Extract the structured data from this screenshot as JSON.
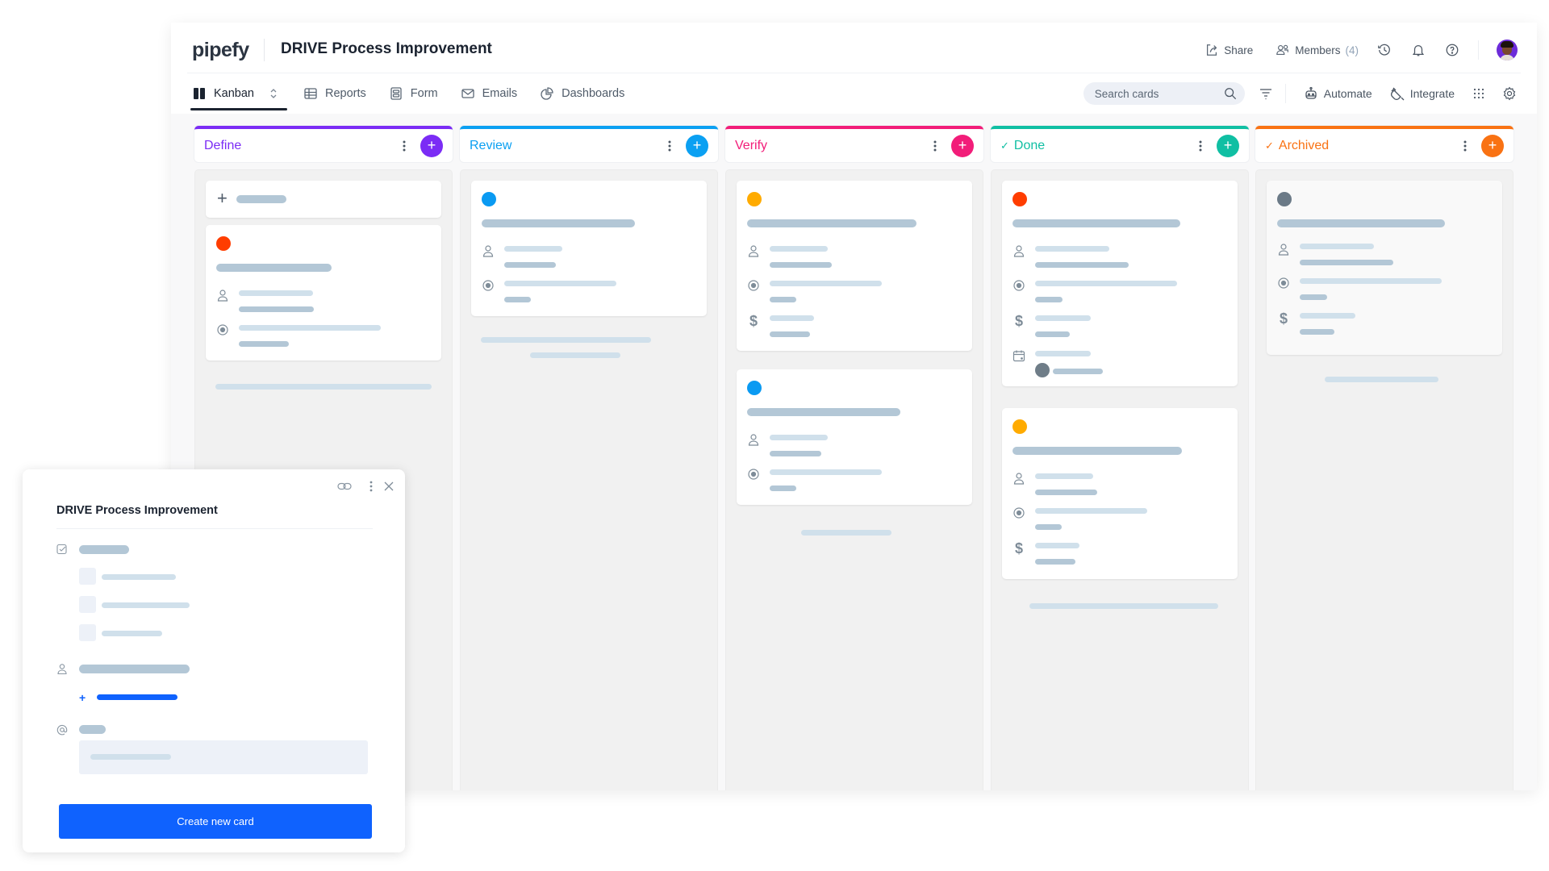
{
  "header": {
    "logo": "pipefy",
    "title": "DRIVE Process Improvement",
    "share_label": "Share",
    "members_label": "Members",
    "members_count": "(4)",
    "icons": [
      "history-icon",
      "bell-icon",
      "help-icon"
    ],
    "avatar": "user-avatar"
  },
  "tabs": [
    {
      "label": "Kanban",
      "icon": "kanban-icon",
      "active": true
    },
    {
      "label": "Reports",
      "icon": "table-icon",
      "active": false
    },
    {
      "label": "Form",
      "icon": "form-icon",
      "active": false
    },
    {
      "label": "Emails",
      "icon": "mail-icon",
      "active": false
    },
    {
      "label": "Dashboards",
      "icon": "pie-chart-icon",
      "active": false
    }
  ],
  "toolbar": {
    "search_placeholder": "Search cards",
    "automate_label": "Automate",
    "integrate_label": "Integrate"
  },
  "columns": [
    {
      "title": "Define",
      "color": "#7b2cf5",
      "done_check": false
    },
    {
      "title": "Review",
      "color": "#0ba0f2",
      "done_check": false
    },
    {
      "title": "Verify",
      "color": "#f21d79",
      "done_check": false
    },
    {
      "title": "Done",
      "color": "#10bfa3",
      "done_check": true
    },
    {
      "title": "Archived",
      "color": "#f97213",
      "done_check": true
    }
  ],
  "card_colors": {
    "red": "#ff3d00",
    "blue": "#0a9af2",
    "amber": "#ffab00",
    "gray": "#6b7a87"
  },
  "modal": {
    "title": "DRIVE Process Improvement",
    "create_button": "Create new card",
    "icons": [
      "link-icon",
      "more-vertical-icon",
      "close-icon"
    ]
  },
  "glyphs": {
    "plus": "+",
    "check": "✓",
    "dollar": "$",
    "close": "×"
  }
}
